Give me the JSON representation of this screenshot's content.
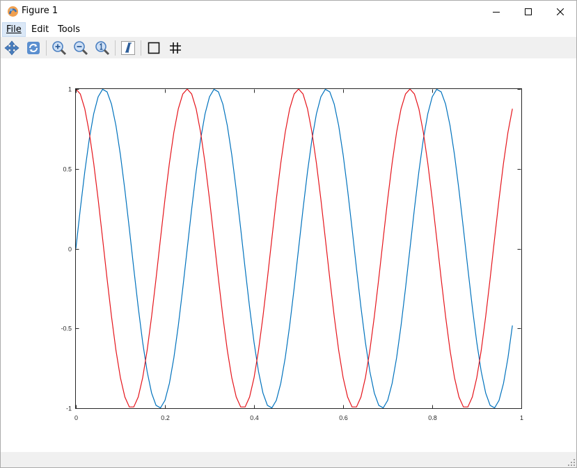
{
  "window": {
    "title": "Figure 1",
    "app_icon": "octave-icon",
    "controls": [
      "minimize-icon",
      "maximize-icon",
      "close-icon"
    ]
  },
  "menubar": {
    "items": [
      {
        "label": "File",
        "active": true
      },
      {
        "label": "Edit",
        "active": false
      },
      {
        "label": "Tools",
        "active": false
      }
    ]
  },
  "toolbar": {
    "tools": [
      "pan-icon",
      "rotate-icon",
      "zoom-in-icon",
      "zoom-out-icon",
      "zoom-reset-icon",
      "insert-text-icon",
      "axes-box-icon",
      "grid-icon"
    ]
  },
  "chart_data": {
    "type": "line",
    "title": "",
    "xlabel": "",
    "ylabel": "",
    "xlim": [
      0,
      1
    ],
    "ylim": [
      -1,
      1
    ],
    "grid": false,
    "x_ticks": [
      "0",
      "0.2",
      "0.4",
      "0.6",
      "0.8",
      "1"
    ],
    "y_ticks": [
      "1",
      "0.5",
      "0",
      "-0.5",
      "-1"
    ],
    "x_tick_values": [
      0,
      0.2,
      0.4,
      0.6,
      0.8,
      1
    ],
    "y_tick_values": [
      1,
      0.5,
      0,
      -0.5,
      -1
    ],
    "x": [
      0,
      0.01,
      0.02,
      0.03,
      0.04,
      0.05,
      0.06,
      0.07,
      0.08,
      0.09,
      0.1,
      0.11,
      0.12,
      0.13,
      0.14,
      0.15,
      0.16,
      0.17,
      0.18,
      0.19,
      0.2,
      0.21,
      0.22,
      0.23,
      0.24,
      0.25,
      0.26,
      0.27,
      0.28,
      0.29,
      0.3,
      0.31,
      0.32,
      0.33,
      0.34,
      0.35,
      0.36,
      0.37,
      0.38,
      0.39,
      0.4,
      0.41,
      0.42,
      0.43,
      0.44,
      0.45,
      0.46,
      0.47,
      0.48,
      0.49,
      0.5,
      0.51,
      0.52,
      0.53,
      0.54,
      0.55,
      0.56,
      0.57,
      0.58,
      0.59,
      0.6,
      0.61,
      0.62,
      0.63,
      0.64,
      0.65,
      0.66,
      0.67,
      0.68,
      0.69,
      0.7,
      0.71,
      0.72,
      0.73,
      0.74,
      0.75,
      0.76,
      0.77,
      0.78,
      0.79,
      0.8,
      0.81,
      0.82,
      0.83,
      0.84,
      0.85,
      0.86,
      0.87,
      0.88,
      0.89,
      0.9,
      0.91,
      0.92,
      0.93,
      0.94,
      0.95,
      0.96,
      0.97,
      0.98
    ],
    "series": [
      {
        "color": "#0072bd",
        "values": [
          0,
          0.2487,
          0.4818,
          0.6845,
          0.8443,
          0.9511,
          0.998,
          0.9823,
          0.9048,
          0.7705,
          0.5878,
          0.3681,
          0.1253,
          -0.1253,
          -0.3681,
          -0.5878,
          -0.7705,
          -0.9048,
          -0.9823,
          -0.998,
          -0.9511,
          -0.8443,
          -0.6845,
          -0.4818,
          -0.2487,
          0,
          0.2487,
          0.4818,
          0.6845,
          0.8443,
          0.9511,
          0.998,
          0.9823,
          0.9048,
          0.7705,
          0.5878,
          0.3681,
          0.1253,
          -0.1253,
          -0.3681,
          -0.5878,
          -0.7705,
          -0.9048,
          -0.9823,
          -0.998,
          -0.9511,
          -0.8443,
          -0.6845,
          -0.4818,
          -0.2487,
          0,
          0.2487,
          0.4818,
          0.6845,
          0.8443,
          0.9511,
          0.998,
          0.9823,
          0.9048,
          0.7705,
          0.5878,
          0.3681,
          0.1253,
          -0.1253,
          -0.3681,
          -0.5878,
          -0.7705,
          -0.9048,
          -0.9823,
          -0.998,
          -0.9511,
          -0.8443,
          -0.6845,
          -0.4818,
          -0.2487,
          0,
          0.2487,
          0.4818,
          0.6845,
          0.8443,
          0.9511,
          0.998,
          0.9823,
          0.9048,
          0.7705,
          0.5878,
          0.3681,
          0.1253,
          -0.1253,
          -0.3681,
          -0.5878,
          -0.7705,
          -0.9048,
          -0.9823,
          -0.998,
          -0.9511,
          -0.8443,
          -0.6845,
          -0.4818
        ]
      },
      {
        "color": "#e5141b",
        "values": [
          1,
          0.9686,
          0.8763,
          0.729,
          0.5358,
          0.309,
          0.0628,
          -0.1874,
          -0.4258,
          -0.6374,
          -0.809,
          -0.9298,
          -0.9921,
          -0.9921,
          -0.9298,
          -0.809,
          -0.6374,
          -0.4258,
          -0.1874,
          0.0628,
          0.309,
          0.5358,
          0.729,
          0.8763,
          0.9686,
          1,
          0.9686,
          0.8763,
          0.729,
          0.5358,
          0.309,
          0.0628,
          -0.1874,
          -0.4258,
          -0.6374,
          -0.809,
          -0.9298,
          -0.9921,
          -0.9921,
          -0.9298,
          -0.809,
          -0.6374,
          -0.4258,
          -0.1874,
          0.0628,
          0.309,
          0.5358,
          0.729,
          0.8763,
          0.9686,
          1,
          0.9686,
          0.8763,
          0.729,
          0.5358,
          0.309,
          0.0628,
          -0.1874,
          -0.4258,
          -0.6374,
          -0.809,
          -0.9298,
          -0.9921,
          -0.9921,
          -0.9298,
          -0.809,
          -0.6374,
          -0.4258,
          -0.1874,
          0.0628,
          0.309,
          0.5358,
          0.729,
          0.8763,
          0.9686,
          1,
          0.9686,
          0.8763,
          0.729,
          0.5358,
          0.309,
          0.0628,
          -0.1874,
          -0.4258,
          -0.6374,
          -0.809,
          -0.9298,
          -0.9921,
          -0.9921,
          -0.9298,
          -0.809,
          -0.6374,
          -0.4258,
          -0.1874,
          0.0628,
          0.309,
          0.5358,
          0.729,
          0.8763
        ]
      }
    ]
  }
}
